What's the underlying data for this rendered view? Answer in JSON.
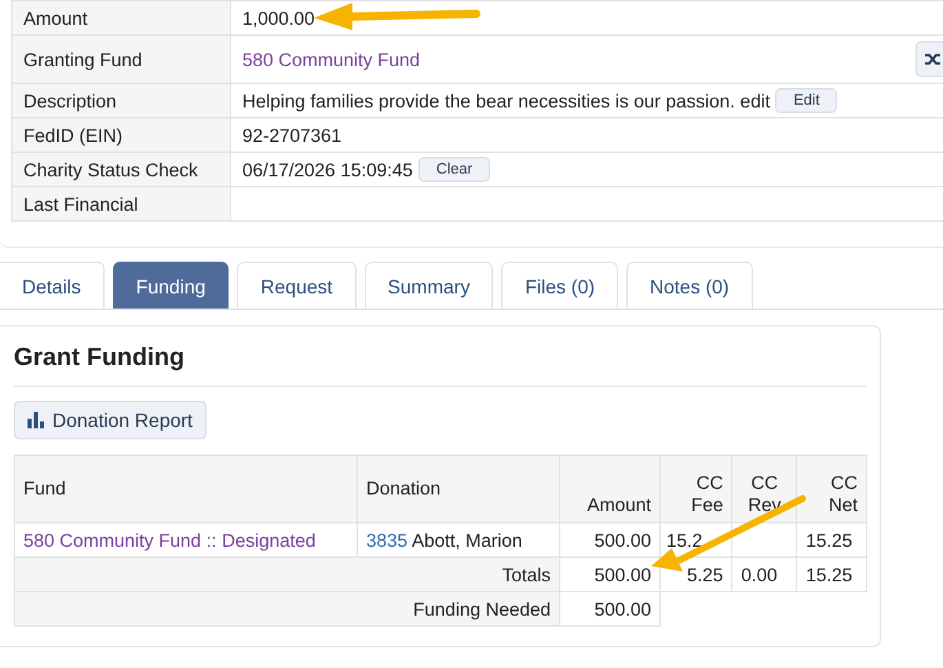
{
  "details": [
    {
      "label": "Amount",
      "kind": "text",
      "value": "1,000.00"
    },
    {
      "label": "Granting Fund",
      "kind": "link",
      "value": "580 Community Fund",
      "side_button": true
    },
    {
      "label": "Description",
      "kind": "text",
      "value": "Helping families provide the bear necessities is our passion. edit",
      "button": "Edit"
    },
    {
      "label": "FedID (EIN)",
      "kind": "text",
      "value": "92-2707361"
    },
    {
      "label": "Charity Status Check",
      "kind": "text",
      "value": "06/17/2026 15:09:45",
      "button": "Clear"
    },
    {
      "label": "Last Financial",
      "kind": "text"
    }
  ],
  "tabs": [
    {
      "label": "Details",
      "selected": false
    },
    {
      "label": "Funding",
      "selected": true
    },
    {
      "label": "Request",
      "selected": false
    },
    {
      "label": "Summary",
      "selected": false
    },
    {
      "label": "Files (0)",
      "selected": false
    },
    {
      "label": "Notes (0)",
      "selected": false
    }
  ],
  "funding": {
    "title": "Grant Funding",
    "report_button": "Donation Report",
    "columns": [
      "Fund",
      "Donation",
      "Amount",
      "CC Fee",
      "CC Rev",
      "CC Net"
    ],
    "rows": [
      {
        "fund": "580 Community Fund :: Designated",
        "donation_id": "3835",
        "donation_name": "Abott, Marion",
        "amount": "500.00",
        "cc_fee": "15.2",
        "cc_net": "15.25"
      }
    ],
    "totals": {
      "label": "Totals",
      "amount": "500.00",
      "cc_fee": "5.25",
      "cc_rev": "0.00",
      "cc_net": "15.25"
    },
    "needed": {
      "label": "Funding Needed",
      "amount": "500.00"
    }
  }
}
